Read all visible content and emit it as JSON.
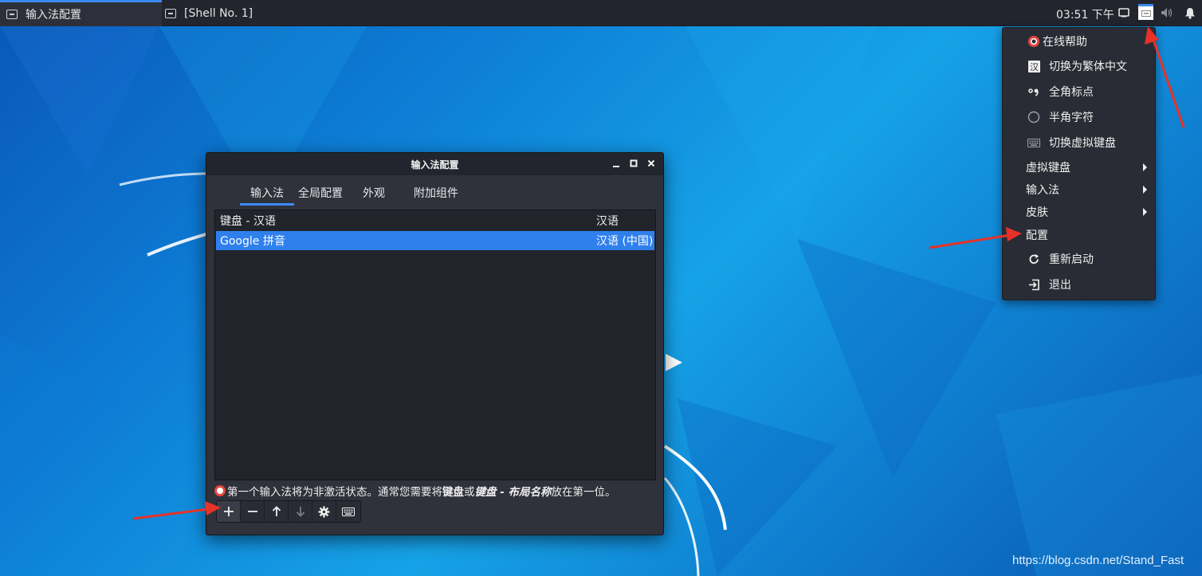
{
  "taskbar": {
    "tasks": [
      {
        "label": "输入法配置",
        "active": true
      },
      {
        "label": "[Shell No. 1]",
        "active": false
      }
    ],
    "clock": "03:51 下午",
    "tray_icons": [
      "screen-icon",
      "keyboard-indicator-icon",
      "volume-icon",
      "notification-bell-icon"
    ]
  },
  "tray_menu": {
    "items": [
      {
        "label": "在线帮助",
        "icon": "lifebuoy-icon"
      },
      {
        "label": "切换为繁体中文",
        "icon": "han-char-icon"
      },
      {
        "label": "全角标点",
        "icon": "fullwidth-punct-icon"
      },
      {
        "label": "半角字符",
        "icon": "halfwidth-circle-icon"
      },
      {
        "label": "切换虚拟键盘",
        "icon": "keyboard-icon"
      }
    ],
    "submenus": [
      {
        "label": "虚拟键盘"
      },
      {
        "label": "输入法"
      },
      {
        "label": "皮肤"
      }
    ],
    "config_label": "配置",
    "restart": {
      "label": "重新启动",
      "icon": "restart-icon"
    },
    "quit": {
      "label": "退出",
      "icon": "exit-icon"
    }
  },
  "dialog": {
    "title": "输入法配置",
    "tabs": [
      "输入法",
      "全局配置",
      "外观",
      "附加组件"
    ],
    "active_tab": "输入法",
    "rows": [
      {
        "name": "键盘 - 汉语",
        "lang": "汉语",
        "selected": false
      },
      {
        "name": "Google 拼音",
        "lang": "汉语 (中国)",
        "selected": true
      }
    ],
    "hint": {
      "p1": "第一个输入法将为非激活状态。通常您需要将",
      "b1": "键盘",
      "p2": "或",
      "b2": "键盘 - 布局名称",
      "p3": "放在第一位。"
    },
    "toolbar": [
      "add-icon",
      "remove-icon",
      "move-up-icon",
      "move-down-icon",
      "settings-gear-icon",
      "keyboard-layout-icon"
    ]
  },
  "watermark": "https://blog.csdn.net/Stand_Fast",
  "colors": {
    "accent": "#2f80ed",
    "panel": "#23252e",
    "dialog": "#2f313b",
    "annotation_arrow": "#e63228"
  }
}
